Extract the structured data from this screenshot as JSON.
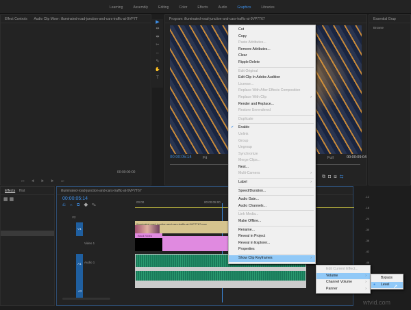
{
  "workspaces": [
    {
      "label": "Learning"
    },
    {
      "label": "Assembly"
    },
    {
      "label": "Editing"
    },
    {
      "label": "Color"
    },
    {
      "label": "Effects"
    },
    {
      "label": "Audio"
    },
    {
      "label": "Graphics"
    },
    {
      "label": "Libraries"
    }
  ],
  "active_workspace": "Graphics",
  "source_panel": {
    "tab1": "Effect Controls",
    "tab2": "Audio Clip Mixer: illuminated-road-junction-and-cars-traffic-at-9VP7T",
    "timecode": "00:00:00:00"
  },
  "program": {
    "title": "Program: illuminated-road-junction-and-cars-traffic-at-9VP7T67",
    "timecode": "00:00:05:14",
    "fit": "Fit",
    "quality": "Full",
    "duration": "00:00:09:04"
  },
  "right_panel": {
    "title": "Essential Grap",
    "tab": "Browse"
  },
  "effects_panel": {
    "tabs": [
      "Effects",
      "Hist"
    ]
  },
  "timeline": {
    "title": "illuminated-road-junction-and-cars-traffic-at-9VP7T67",
    "timecode": "00:00:05:14",
    "ruler": [
      "00:00",
      "00:00:05:00"
    ],
    "tracks": {
      "v2": "V2",
      "v1": "V1",
      "v1_name": "Video 1",
      "a1": "A1",
      "a1_name": "Audio 1",
      "a2": "A2"
    },
    "clip_name": "illuminated-road-junction-and-cars-traffic-at-9VP7T67.mov",
    "black_video": "Black Video"
  },
  "meter": [
    "-12",
    "-18",
    "-24",
    "-30",
    "-36",
    "-42",
    "-48"
  ],
  "context_menu": [
    {
      "label": "Cut"
    },
    {
      "label": "Copy"
    },
    {
      "label": "Paste Attributes...",
      "disabled": true
    },
    {
      "label": "Remove Attributes..."
    },
    {
      "label": "Clear"
    },
    {
      "label": "Ripple Delete"
    },
    {
      "sep": true
    },
    {
      "label": "Edit Original",
      "disabled": true
    },
    {
      "label": "Edit Clip In Adobe Audition"
    },
    {
      "label": "License...",
      "disabled": true
    },
    {
      "label": "Replace With After Effects Composition",
      "disabled": true
    },
    {
      "label": "Replace With Clip",
      "disabled": true,
      "submenu": true
    },
    {
      "label": "Render and Replace..."
    },
    {
      "label": "Restore Unrendered",
      "disabled": true
    },
    {
      "sep": true
    },
    {
      "label": "Duplicate",
      "disabled": true
    },
    {
      "sep": true
    },
    {
      "label": "Enable",
      "checked": true
    },
    {
      "label": "Unlink",
      "disabled": true
    },
    {
      "label": "Group",
      "disabled": true
    },
    {
      "label": "Ungroup",
      "disabled": true
    },
    {
      "label": "Synchronize",
      "disabled": true
    },
    {
      "label": "Merge Clips...",
      "disabled": true
    },
    {
      "label": "Nest..."
    },
    {
      "label": "Multi-Camera",
      "disabled": true,
      "submenu": true
    },
    {
      "sep": true
    },
    {
      "label": "Label",
      "submenu": true
    },
    {
      "sep": true
    },
    {
      "label": "Speed/Duration..."
    },
    {
      "sep": true
    },
    {
      "label": "Audio Gain..."
    },
    {
      "label": "Audio Channels..."
    },
    {
      "sep": true
    },
    {
      "label": "Link Media...",
      "disabled": true
    },
    {
      "label": "Make Offline..."
    },
    {
      "sep": true
    },
    {
      "label": "Rename..."
    },
    {
      "label": "Reveal in Project"
    },
    {
      "label": "Reveal in Explorer..."
    },
    {
      "label": "Properties"
    },
    {
      "sep": true
    },
    {
      "label": "Show Clip Keyframes",
      "highlighted": true,
      "submenu": true
    }
  ],
  "keyframes_submenu": [
    {
      "label": "Edit Current Effect...",
      "disabled": true
    },
    {
      "label": "Volume",
      "highlighted": true,
      "submenu": true
    },
    {
      "label": "Channel Volume",
      "submenu": true
    },
    {
      "label": "Panner",
      "submenu": true
    }
  ],
  "volume_submenu": [
    {
      "label": "Bypass"
    },
    {
      "label": "Level",
      "highlighted": true,
      "checked": true
    }
  ],
  "watermark": "wtvid.com"
}
